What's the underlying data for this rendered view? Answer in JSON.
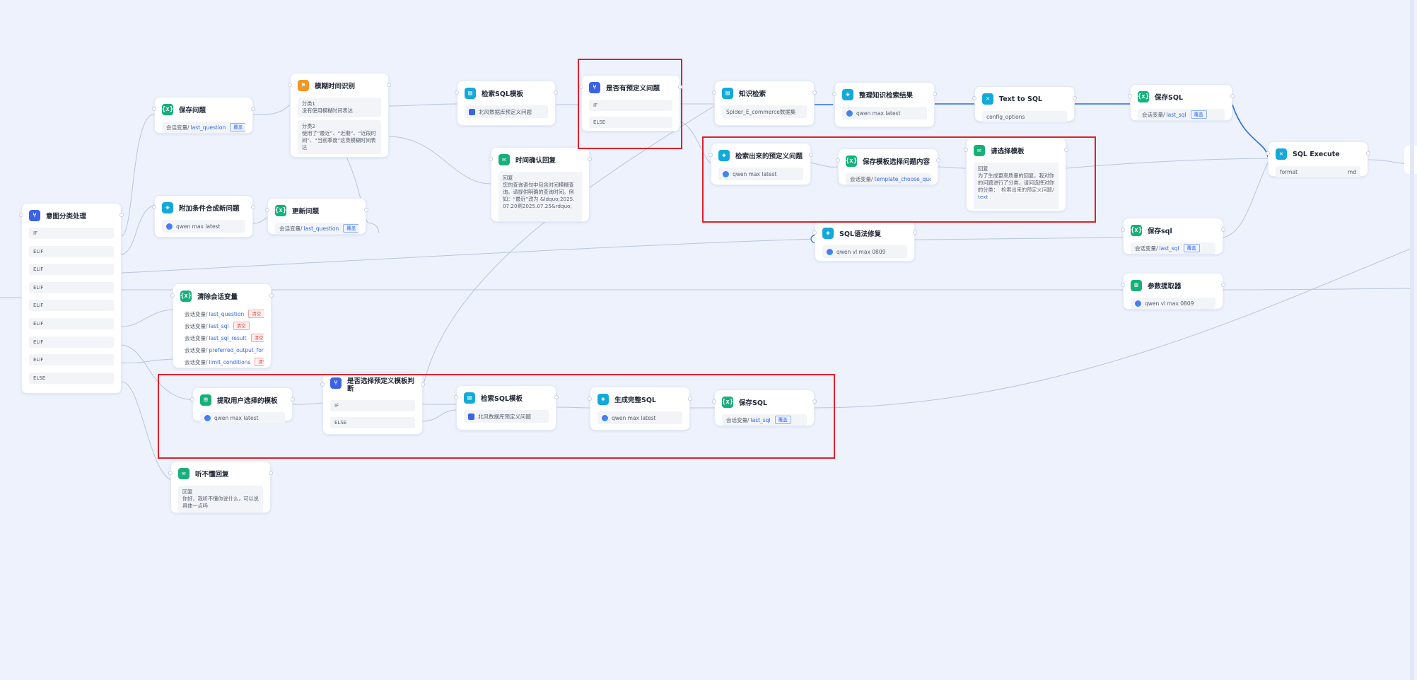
{
  "colors": {
    "background": "#edf2fd",
    "highlight": "#e0202a",
    "edge": "#b9c5dc",
    "edge_active": "#2b6ae6"
  },
  "nodes": {
    "intent": {
      "title": "意图分类处理",
      "icon": "classifier-icon",
      "branches": [
        "IF",
        "ELIF",
        "ELIF",
        "ELIF",
        "ELIF",
        "ELIF",
        "ELIF",
        "ELIF",
        "ELSE"
      ]
    },
    "save_question": {
      "title": "保存问题",
      "prefix": "会话变量/",
      "var": "last_question",
      "tag": "覆盖"
    },
    "append_condition": {
      "title": "附加条件合成新问题",
      "model": "qwen max latest"
    },
    "update_question": {
      "title": "更新问题",
      "prefix": "会话变量/",
      "var": "last_question",
      "tag": "覆盖"
    },
    "clear_vars": {
      "title": "清除会话变量",
      "rows": [
        {
          "prefix": "会话变量/",
          "var": "last_question",
          "tag": "清空"
        },
        {
          "prefix": "会话变量/",
          "var": "last_sql",
          "tag": "清空"
        },
        {
          "prefix": "会话变量/",
          "var": "last_sql_result",
          "tag": "清空"
        },
        {
          "prefix": "会话变量/",
          "var": "preferred_output_format",
          "tag": ""
        },
        {
          "prefix": "会话变量/",
          "var": "limit_conditions",
          "tag": "清空"
        }
      ]
    },
    "extract_template": {
      "title": "提取用户选择的模板",
      "model": "qwen max latest"
    },
    "not_understood": {
      "title": "听不懂回复",
      "label": "回复",
      "text": "你好，我听不懂你说什么，可以说具体一点吗"
    },
    "fuzzy_time": {
      "title": "模糊时间识别",
      "categories": [
        {
          "label": "分类1",
          "text": "没有使用模糊时间表达"
        },
        {
          "label": "分类2",
          "text": "使用了“最近”、“近期”、“近段时间”、“当前季度”这类模糊时间表达"
        }
      ]
    },
    "search_sql_template": {
      "title": "检索SQL模板",
      "kb": "北风数据库预定义问题"
    },
    "time_confirm": {
      "title": "时间确认回复",
      "label": "回复",
      "text": "您的查询语句中包含时间模糊查询。请提供明确的查询时间。例如：“最近”改为 &ldquo;2025.07.20到2025.07.25&rdquo;"
    },
    "is_predefined": {
      "title": "是否有预定义问题",
      "branches": [
        "IF",
        "ELSE"
      ]
    },
    "is_choose_template": {
      "title": "是否选择预定义模板判断",
      "branches": [
        "IF",
        "ELSE"
      ]
    },
    "search_sql_template2": {
      "title": "检索SQL模板",
      "kb": "北风数据库预定义问题"
    },
    "gen_full_sql": {
      "title": "生成完整SQL",
      "model": "qwen max latest"
    },
    "save_sql_bottom": {
      "title": "保存SQL",
      "prefix": "会话变量/",
      "var": "last_sql",
      "tag": "覆盖"
    },
    "knowledge_search": {
      "title": "知识检索",
      "kb": "Spider_E_commerce数据集"
    },
    "organize_results": {
      "title": "整理知识检索结果",
      "model": "qwen max latest"
    },
    "text_to_sql": {
      "title": "Text to SQL",
      "param": "config_options"
    },
    "save_sql_top": {
      "title": "保存SQL",
      "prefix": "会话变量/",
      "var": "last_sql",
      "tag": "覆盖"
    },
    "retrieved_predefined": {
      "title": "检索出来的预定义问题",
      "model": "qwen max latest"
    },
    "save_template_content": {
      "title": "保存模板选择问题内容",
      "prefix": "会话变量/",
      "var": "template_choose_question"
    },
    "select_template": {
      "title": "请选择模板",
      "label": "回复",
      "text": "为了生成更高质量的回复，我对你的问题进行了分类，请问选择对你的分类：",
      "inline_tag": "检索出来的预定义问题/",
      "inline_var": "text"
    },
    "sql_execute": {
      "title": "SQL Execute",
      "param": "format",
      "param_value": "md"
    },
    "sql_fix": {
      "title": "SQL语法修复",
      "model": "qwen vl max 0809"
    },
    "save_sql_lower": {
      "title": "保存sql",
      "prefix": "会话变量/",
      "var": "last_sql",
      "tag": "覆盖"
    },
    "param_extractor": {
      "title": "参数提取器",
      "model": "qwen vl max 0809"
    }
  }
}
